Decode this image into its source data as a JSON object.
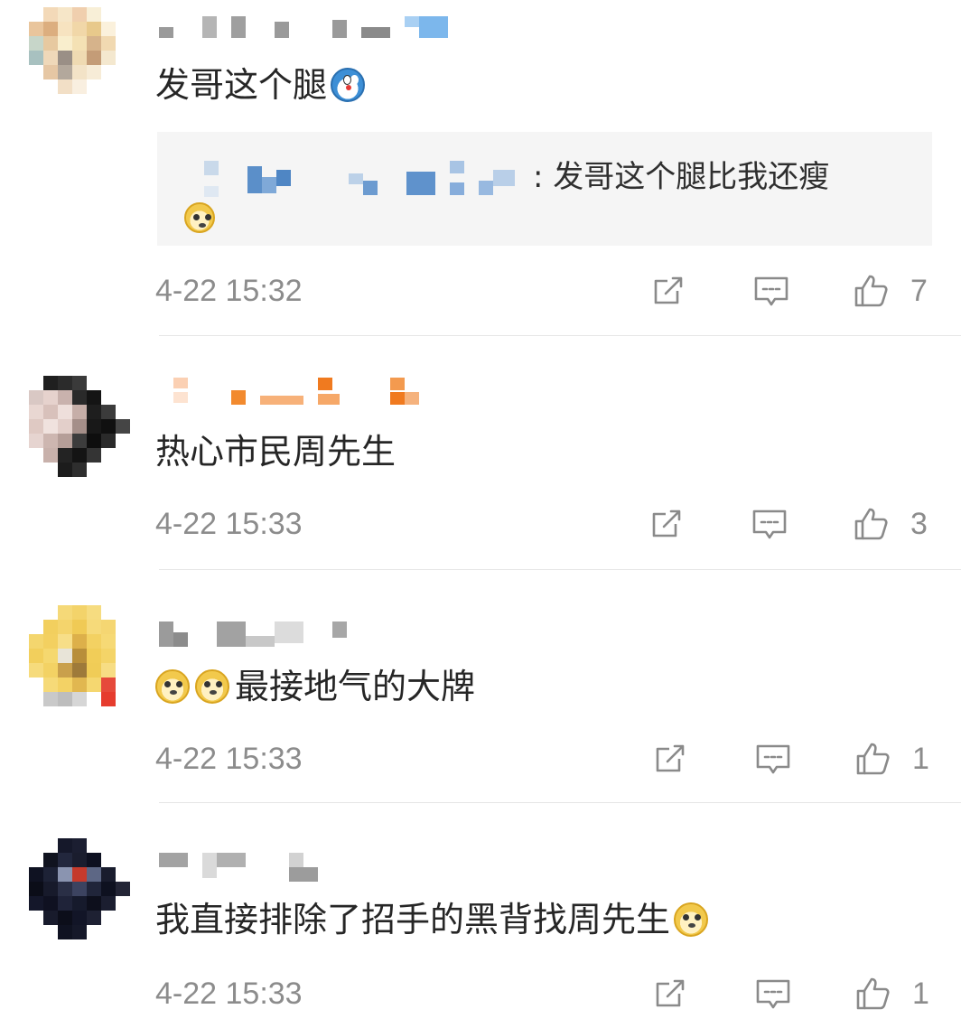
{
  "comments": [
    {
      "text": "发哥这个腿",
      "emoji_after": "doraemon-emoji",
      "reply": {
        "text": ": 发哥这个腿比我还瘦",
        "emoji": "doge-emoji"
      },
      "time": "4-22 15:32",
      "likes": "7"
    },
    {
      "text": "热心市民周先生",
      "time": "4-22 15:33",
      "likes": "3"
    },
    {
      "text": "最接地气的大牌",
      "emoji_before": [
        "doge-emoji",
        "doge-emoji"
      ],
      "time": "4-22 15:33",
      "likes": "1"
    },
    {
      "text": "我直接排除了招手的黑背找周先生",
      "emoji_after": "doge-emoji",
      "time": "4-22 15:33",
      "likes": "1"
    }
  ],
  "icons": {
    "repost": "repost-icon",
    "comment": "comment-icon",
    "like": "like-icon"
  },
  "colors": {
    "meta": "#8c8c8c",
    "text": "#262626",
    "quote_bg": "#f5f5f5",
    "divider": "#e6e6e6"
  }
}
